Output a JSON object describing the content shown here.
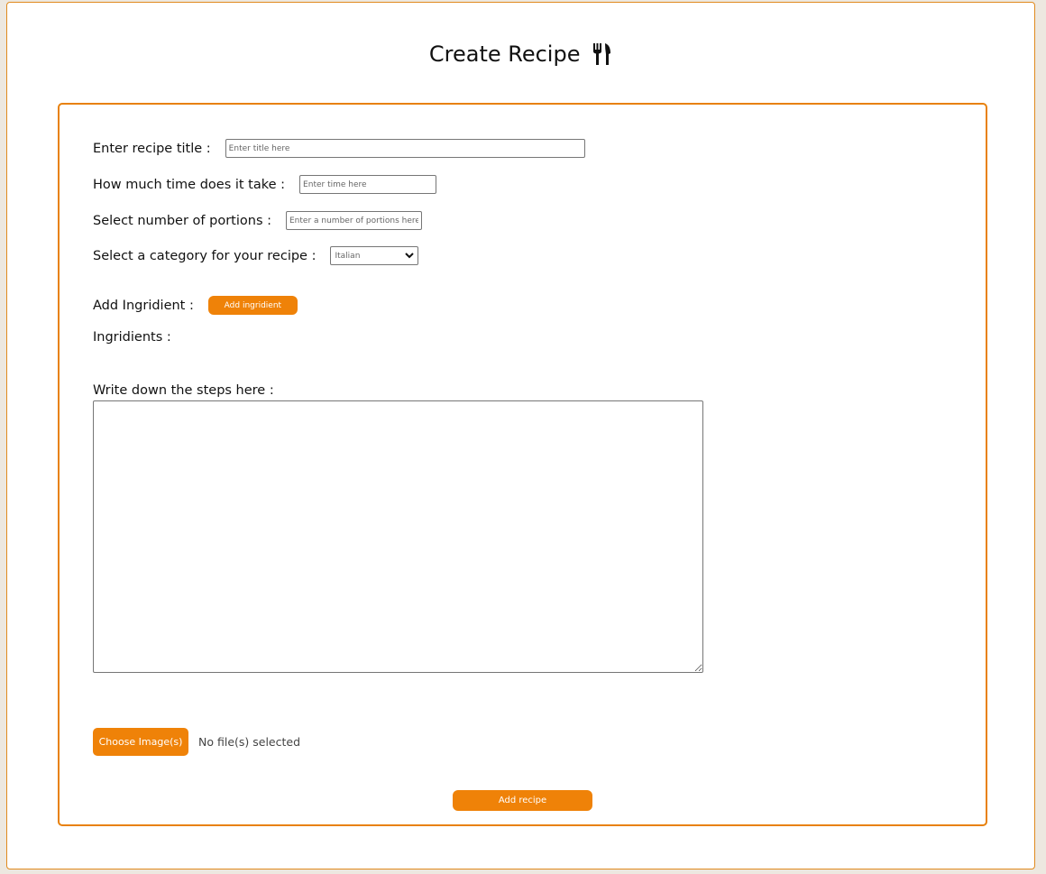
{
  "header": {
    "title": "Create Recipe",
    "icon": "fork-knife-icon"
  },
  "form": {
    "title_label": "Enter recipe title :",
    "title_placeholder": "Enter title here",
    "time_label": "How much time does it take :",
    "time_placeholder": "Enter time here",
    "portions_label": "Select number of portions :",
    "portions_placeholder": "Enter a number of portions here",
    "category_label": "Select a category for your recipe :",
    "category_selected": "Italian",
    "add_ingredient_label": "Add Ingridient :",
    "add_ingredient_button": "Add ingridient",
    "ingredients_label": "Ingridients :",
    "steps_label": "Write down the steps here :",
    "choose_images_button": "Choose Image(s)",
    "file_status": "No file(s) selected",
    "submit_button": "Add recipe"
  },
  "colors": {
    "accent": "#ef8208",
    "border": "#e8810c",
    "background": "#ede8e0"
  }
}
